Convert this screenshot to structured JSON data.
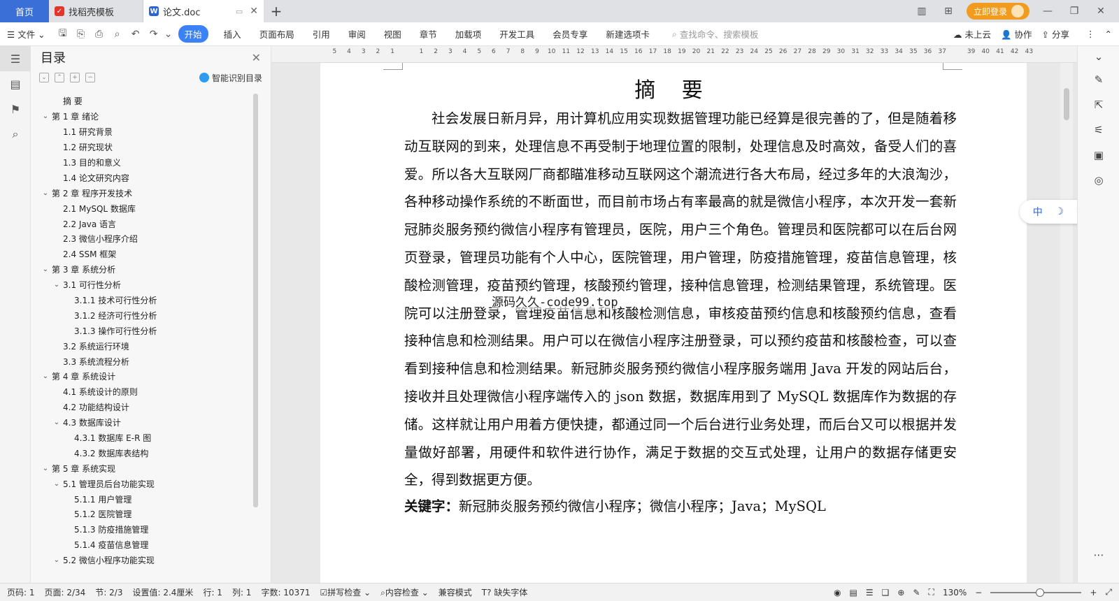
{
  "tabs": {
    "home": "首页",
    "template": "找稻壳模板",
    "doc": "论文.doc"
  },
  "titlebar": {
    "login": "立即登录"
  },
  "toolbar": {
    "file": "文件",
    "menus": [
      "开始",
      "插入",
      "页面布局",
      "引用",
      "审阅",
      "视图",
      "章节",
      "加载项",
      "开发工具",
      "会员专享",
      "新建选项卡"
    ],
    "search_placeholder": "查找命令、搜索模板",
    "cloud": "未上云",
    "collab": "协作",
    "share": "分享"
  },
  "toc": {
    "title": "目录",
    "smart": "智能识别目录",
    "items": [
      {
        "label": "摘    要",
        "level": 1,
        "chev": ""
      },
      {
        "label": "第 1 章  绪论",
        "level": 0,
        "chev": "⌄"
      },
      {
        "label": "1.1  研究背景",
        "level": 2,
        "chev": ""
      },
      {
        "label": "1.2  研究现状",
        "level": 2,
        "chev": ""
      },
      {
        "label": "1.3  目的和意义",
        "level": 2,
        "chev": ""
      },
      {
        "label": "1.4  论文研究内容",
        "level": 2,
        "chev": ""
      },
      {
        "label": "第 2 章  程序开发技术",
        "level": 0,
        "chev": "⌄"
      },
      {
        "label": "2.1 MySQL 数据库",
        "level": 2,
        "chev": ""
      },
      {
        "label": "2.2 Java 语言",
        "level": 2,
        "chev": ""
      },
      {
        "label": "2.3  微信小程序介绍",
        "level": 2,
        "chev": ""
      },
      {
        "label": "2.4 SSM 框架",
        "level": 2,
        "chev": ""
      },
      {
        "label": "第 3 章  系统分析",
        "level": 0,
        "chev": "⌄"
      },
      {
        "label": "3.1 可行性分析",
        "level": 1,
        "chev": "⌄"
      },
      {
        "label": "3.1.1 技术可行性分析",
        "level": 3,
        "chev": ""
      },
      {
        "label": "3.1.2 经济可行性分析",
        "level": 3,
        "chev": ""
      },
      {
        "label": "3.1.3 操作可行性分析",
        "level": 3,
        "chev": ""
      },
      {
        "label": "3.2 系统运行环境",
        "level": 2,
        "chev": ""
      },
      {
        "label": "3.3 系统流程分析",
        "level": 2,
        "chev": ""
      },
      {
        "label": "第 4 章  系统设计",
        "level": 0,
        "chev": "⌄"
      },
      {
        "label": "4.1  系统设计的原则",
        "level": 2,
        "chev": ""
      },
      {
        "label": "4.2  功能结构设计",
        "level": 2,
        "chev": ""
      },
      {
        "label": "4.3  数据库设计",
        "level": 1,
        "chev": "⌄"
      },
      {
        "label": "4.3.1  数据库 E-R 图",
        "level": 3,
        "chev": ""
      },
      {
        "label": "4.3.2  数据库表结构",
        "level": 3,
        "chev": ""
      },
      {
        "label": "第 5 章  系统实现",
        "level": 0,
        "chev": "⌄"
      },
      {
        "label": "5.1 管理员后台功能实现",
        "level": 1,
        "chev": "⌄"
      },
      {
        "label": "5.1.1  用户管理",
        "level": 3,
        "chev": ""
      },
      {
        "label": "5.1.2  医院管理",
        "level": 3,
        "chev": ""
      },
      {
        "label": "5.1.3  防疫措施管理",
        "level": 3,
        "chev": ""
      },
      {
        "label": "5.1.4  疫苗信息管理",
        "level": 3,
        "chev": ""
      },
      {
        "label": "5.2  微信小程序功能实现",
        "level": 1,
        "chev": "⌄"
      }
    ]
  },
  "ruler": [
    "5",
    "4",
    "3",
    "2",
    "1",
    "",
    "1",
    "2",
    "3",
    "4",
    "5",
    "6",
    "7",
    "8",
    "9",
    "10",
    "11",
    "12",
    "13",
    "14",
    "15",
    "16",
    "17",
    "18",
    "19",
    "20",
    "21",
    "22",
    "23",
    "24",
    "25",
    "26",
    "27",
    "28",
    "29",
    "30",
    "31",
    "32",
    "33",
    "34",
    "35",
    "36",
    "37",
    "",
    "39",
    "40",
    "41",
    "42",
    "43"
  ],
  "document": {
    "title": "摘  要",
    "body": "社会发展日新月异，用计算机应用实现数据管理功能已经算是很完善的了，但是随着移动互联网的到来，处理信息不再受制于地理位置的限制，处理信息及时高效，备受人们的喜爱。所以各大互联网厂商都瞄准移动互联网这个潮流进行各大布局，经过多年的大浪淘沙，各种移动操作系统的不断面世，而目前市场占有率最高的就是微信小程序，本次开发一套新冠肺炎服务预约微信小程序有管理员，医院，用户三个角色。管理员和医院都可以在后台网页登录，管理员功能有个人中心，医院管理，用户管理，防疫措施管理，疫苗信息管理，核酸检测管理，疫苗预约管理，核酸预约管理，接种信息管理，检测结果管理，系统管理。医院可以注册登录，管理疫苗信息和核酸检测信息，审核疫苗预约信息和核酸预约信息，查看接种信息和检测结果。用户可以在微信小程序注册登录，可以预约疫苗和核酸检查，可以查看到接种信息和检测结果。新冠肺炎服务预约微信小程序服务端用 Java 开发的网站后台，接收并且处理微信小程序端传入的 json 数据，数据库用到了 MySQL 数据库作为数据的存储。这样就让用户用着方便快捷，都通过同一个后台进行业务处理，而后台又可以根据并发量做好部署，用硬件和软件进行协作，满足于数据的交互式处理，让用户的数据存储更安全，得到数据更方便。",
    "keywords_label": "关键字：",
    "keywords": "新冠肺炎服务预约微信小程序；微信小程序；Java；MySQL",
    "watermark": "源码久久-code99.top"
  },
  "ime": {
    "lang": "中"
  },
  "status": {
    "page_no": "页码: 1",
    "page": "页面: 2/34",
    "section": "节: 2/3",
    "setting": "设置值: 2.4厘米",
    "row": "行: 1",
    "col": "列: 1",
    "words": "字数: 10371",
    "spell": "拼写检查",
    "content": "内容检查",
    "compat": "兼容模式",
    "missing_font": "缺失字体",
    "zoom": "130%",
    "zoom_fraction": 0.55
  }
}
